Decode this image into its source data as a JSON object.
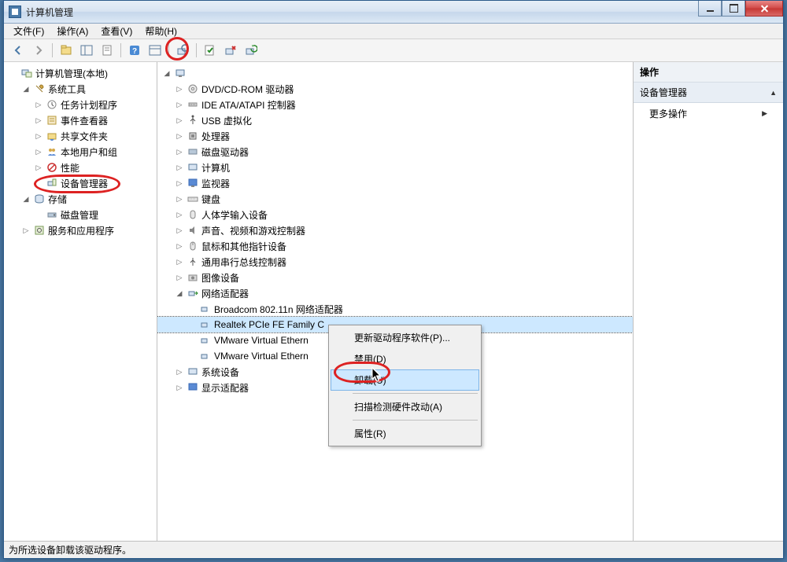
{
  "window": {
    "title": "计算机管理"
  },
  "menu": {
    "file": "文件(F)",
    "action": "操作(A)",
    "view": "查看(V)",
    "help": "帮助(H)"
  },
  "left_tree": {
    "root": "计算机管理(本地)",
    "sys_tools": "系统工具",
    "task_sched": "任务计划程序",
    "event_viewer": "事件查看器",
    "shared": "共享文件夹",
    "local_users": "本地用户和组",
    "perf": "性能",
    "device_mgr": "设备管理器",
    "storage": "存储",
    "disk_mgmt": "磁盘管理",
    "services": "服务和应用程序"
  },
  "mid_tree": {
    "dvd": "DVD/CD-ROM 驱动器",
    "ide": "IDE ATA/ATAPI 控制器",
    "usb_virt": "USB 虚拟化",
    "cpu": "处理器",
    "disk": "磁盘驱动器",
    "computer": "计算机",
    "monitor": "监视器",
    "keyboard": "键盘",
    "hid": "人体学输入设备",
    "sound": "声音、视频和游戏控制器",
    "mouse": "鼠标和其他指针设备",
    "usb_ctrl": "通用串行总线控制器",
    "imaging": "图像设备",
    "network": "网络适配器",
    "net1": "Broadcom 802.11n 网络适配器",
    "net2": "Realtek PCIe FE Family Controller",
    "net2_display": "Realtek PCIe FE Family C",
    "net3": "VMware Virtual Ethern",
    "net4": "VMware Virtual Ethern",
    "sys_dev": "系统设备",
    "display": "显示适配器"
  },
  "ctx": {
    "update": "更新驱动程序软件(P)...",
    "disable": "禁用(D)",
    "uninstall": "卸载(U)",
    "scan": "扫描检测硬件改动(A)",
    "props": "属性(R)"
  },
  "right": {
    "head": "操作",
    "section": "设备管理器",
    "more": "更多操作"
  },
  "status": "为所选设备卸载该驱动程序。"
}
